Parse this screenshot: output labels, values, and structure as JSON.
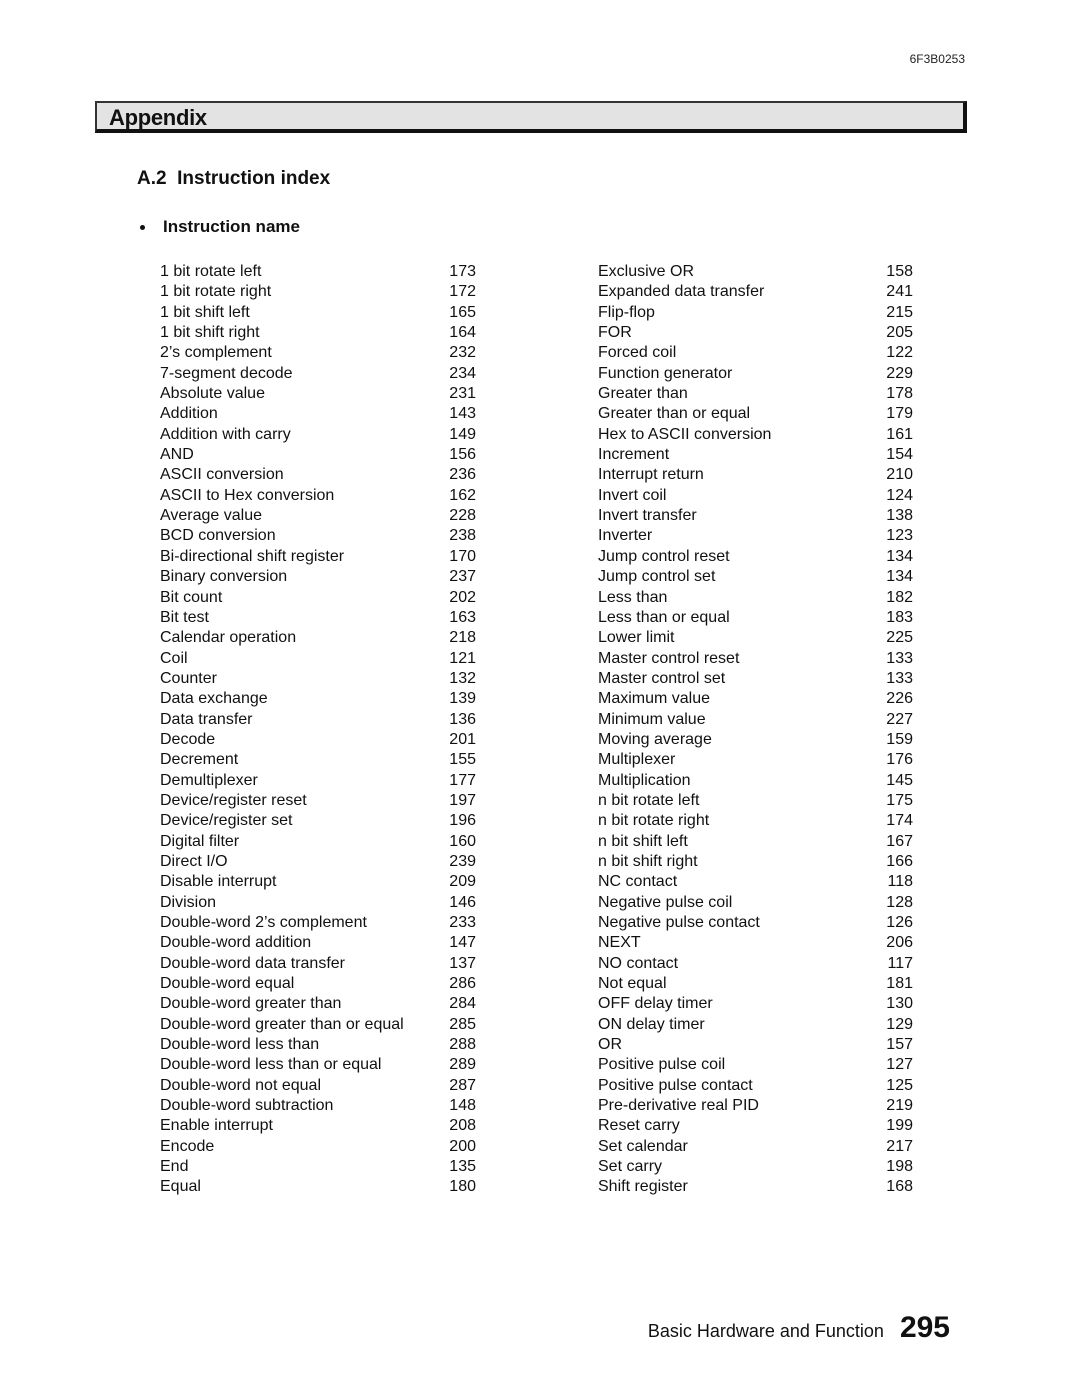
{
  "header": {
    "doc_code": "6F3B0253"
  },
  "banner": {
    "title": "Appendix"
  },
  "section": {
    "title": "A.2  Instruction index"
  },
  "subsection": {
    "title": "Instruction name",
    "bullet_icon": "bullet-icon"
  },
  "index": {
    "left": [
      {
        "name": "1 bit rotate left",
        "page": "173"
      },
      {
        "name": "1 bit rotate right",
        "page": "172"
      },
      {
        "name": "1 bit shift left",
        "page": "165"
      },
      {
        "name": "1 bit shift right",
        "page": "164"
      },
      {
        "name": "2’s complement",
        "page": "232"
      },
      {
        "name": "7-segment decode",
        "page": "234"
      },
      {
        "name": "Absolute value",
        "page": "231"
      },
      {
        "name": "Addition",
        "page": "143"
      },
      {
        "name": "Addition with carry",
        "page": "149"
      },
      {
        "name": "AND",
        "page": "156"
      },
      {
        "name": "ASCII conversion",
        "page": "236"
      },
      {
        "name": "ASCII to Hex conversion",
        "page": "162"
      },
      {
        "name": "Average value",
        "page": "228"
      },
      {
        "name": "BCD conversion",
        "page": "238"
      },
      {
        "name": "Bi-directional shift register",
        "page": "170"
      },
      {
        "name": "Binary conversion",
        "page": "237"
      },
      {
        "name": "Bit count",
        "page": "202"
      },
      {
        "name": "Bit test",
        "page": "163"
      },
      {
        "name": "Calendar operation",
        "page": "218"
      },
      {
        "name": "Coil",
        "page": "121"
      },
      {
        "name": "Counter",
        "page": "132"
      },
      {
        "name": "Data exchange",
        "page": "139"
      },
      {
        "name": "Data transfer",
        "page": "136"
      },
      {
        "name": "Decode",
        "page": "201"
      },
      {
        "name": "Decrement",
        "page": "155"
      },
      {
        "name": "Demultiplexer",
        "page": "177"
      },
      {
        "name": "Device/register reset",
        "page": "197"
      },
      {
        "name": "Device/register set",
        "page": "196"
      },
      {
        "name": "Digital filter",
        "page": "160"
      },
      {
        "name": "Direct I/O",
        "page": "239"
      },
      {
        "name": "Disable interrupt",
        "page": "209"
      },
      {
        "name": "Division",
        "page": "146"
      },
      {
        "name": "Double-word 2’s complement",
        "page": "233"
      },
      {
        "name": "Double-word addition",
        "page": "147"
      },
      {
        "name": "Double-word data transfer",
        "page": "137"
      },
      {
        "name": "Double-word equal",
        "page": "286"
      },
      {
        "name": "Double-word greater than",
        "page": "284"
      },
      {
        "name": "Double-word greater than or equal",
        "page": "285"
      },
      {
        "name": "Double-word less than",
        "page": "288"
      },
      {
        "name": "Double-word less than or equal",
        "page": "289"
      },
      {
        "name": "Double-word not equal",
        "page": "287"
      },
      {
        "name": "Double-word subtraction",
        "page": "148"
      },
      {
        "name": "Enable interrupt",
        "page": "208"
      },
      {
        "name": "Encode",
        "page": "200"
      },
      {
        "name": "End",
        "page": "135"
      },
      {
        "name": "Equal",
        "page": "180"
      }
    ],
    "right": [
      {
        "name": "Exclusive OR",
        "page": "158"
      },
      {
        "name": "Expanded data transfer",
        "page": "241"
      },
      {
        "name": "Flip-flop",
        "page": "215"
      },
      {
        "name": "FOR",
        "page": "205"
      },
      {
        "name": "Forced coil",
        "page": "122"
      },
      {
        "name": "Function generator",
        "page": "229"
      },
      {
        "name": "Greater than",
        "page": "178"
      },
      {
        "name": "Greater than or equal",
        "page": "179"
      },
      {
        "name": "Hex to ASCII conversion",
        "page": "161"
      },
      {
        "name": "Increment",
        "page": "154"
      },
      {
        "name": "Interrupt return",
        "page": "210"
      },
      {
        "name": "Invert coil",
        "page": "124"
      },
      {
        "name": "Invert transfer",
        "page": "138"
      },
      {
        "name": "Inverter",
        "page": "123"
      },
      {
        "name": "Jump control reset",
        "page": "134"
      },
      {
        "name": "Jump control set",
        "page": "134"
      },
      {
        "name": "Less than",
        "page": "182"
      },
      {
        "name": "Less than or equal",
        "page": "183"
      },
      {
        "name": "Lower limit",
        "page": "225"
      },
      {
        "name": "Master control reset",
        "page": "133"
      },
      {
        "name": "Master control set",
        "page": "133"
      },
      {
        "name": "Maximum value",
        "page": "226"
      },
      {
        "name": "Minimum value",
        "page": "227"
      },
      {
        "name": "Moving average",
        "page": "159"
      },
      {
        "name": "Multiplexer",
        "page": "176"
      },
      {
        "name": "Multiplication",
        "page": "145"
      },
      {
        "name": "n bit rotate left",
        "page": "175"
      },
      {
        "name": "n bit rotate right",
        "page": "174"
      },
      {
        "name": "n bit shift left",
        "page": "167"
      },
      {
        "name": "n bit shift right",
        "page": "166"
      },
      {
        "name": "NC contact",
        "page": "118"
      },
      {
        "name": "Negative pulse coil",
        "page": "128"
      },
      {
        "name": "Negative pulse contact",
        "page": "126"
      },
      {
        "name": "NEXT",
        "page": "206"
      },
      {
        "name": "NO contact",
        "page": "117"
      },
      {
        "name": "Not equal",
        "page": "181"
      },
      {
        "name": "OFF delay timer",
        "page": "130"
      },
      {
        "name": "ON delay timer",
        "page": "129"
      },
      {
        "name": "OR",
        "page": "157"
      },
      {
        "name": "Positive pulse coil",
        "page": "127"
      },
      {
        "name": "Positive pulse contact",
        "page": "125"
      },
      {
        "name": "Pre-derivative real PID",
        "page": "219"
      },
      {
        "name": "Reset carry",
        "page": "199"
      },
      {
        "name": "Set calendar",
        "page": "217"
      },
      {
        "name": "Set carry",
        "page": "198"
      },
      {
        "name": "Shift register",
        "page": "168"
      }
    ]
  },
  "footer": {
    "title": "Basic Hardware and Function",
    "page_number": "295"
  }
}
